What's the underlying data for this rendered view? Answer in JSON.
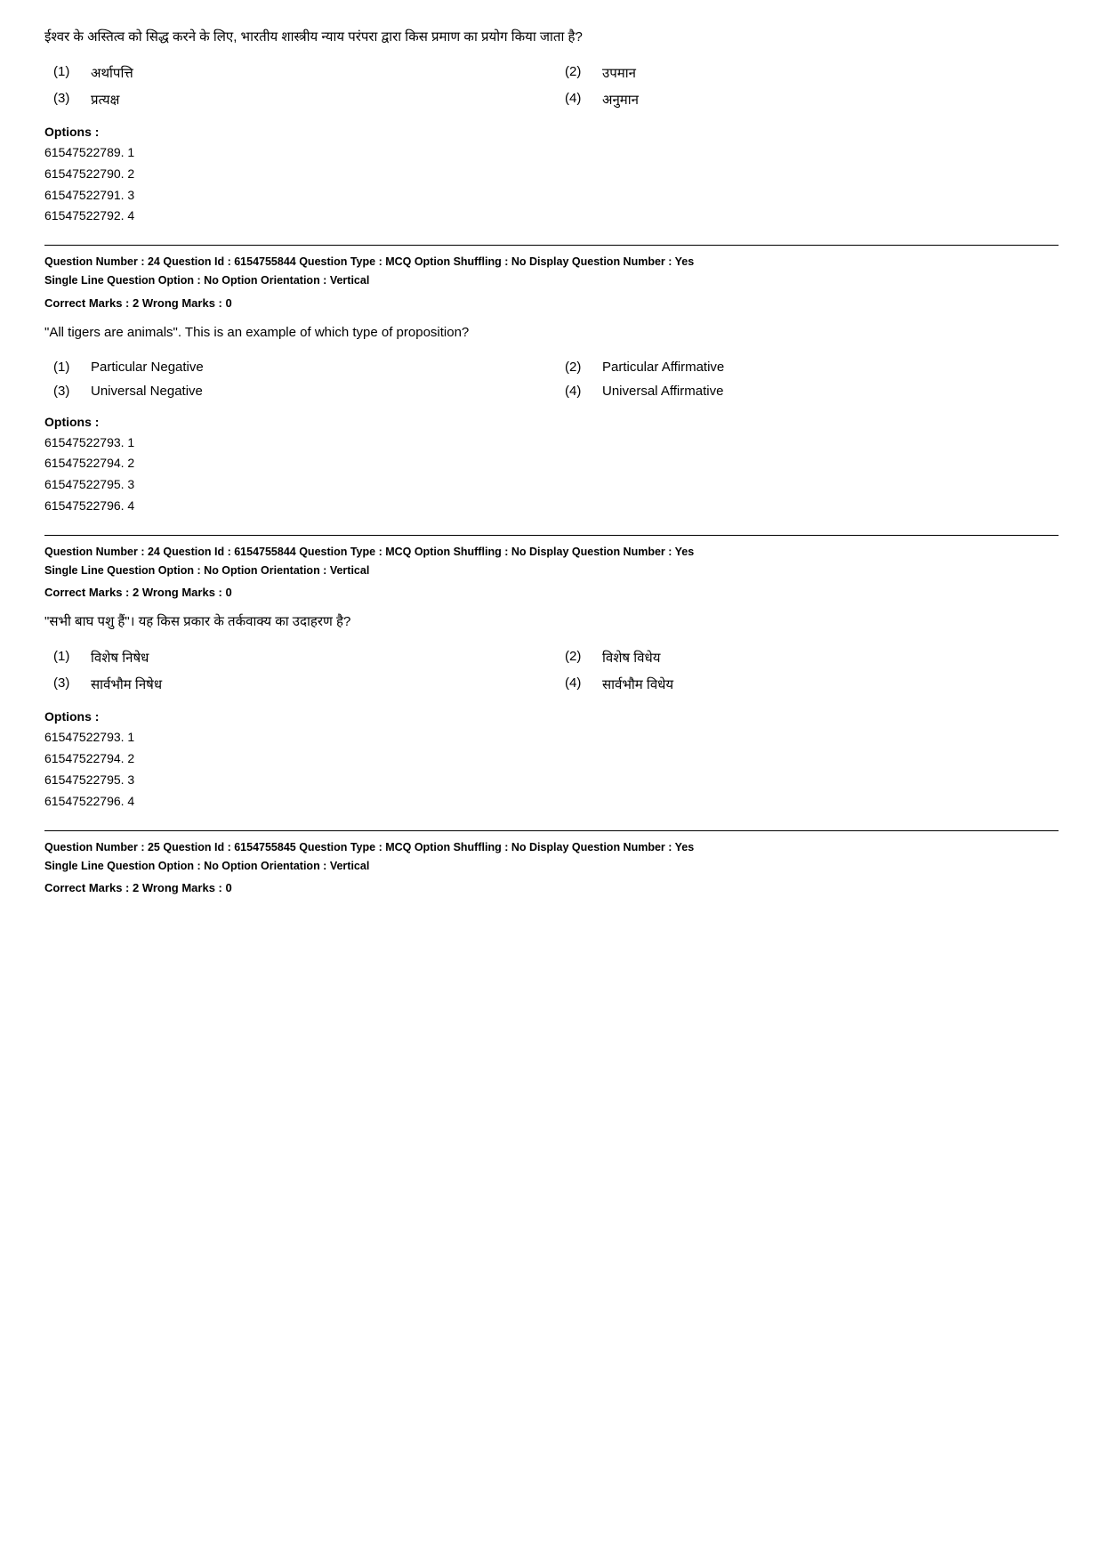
{
  "questions": [
    {
      "id": "q_top",
      "question_text": "ईश्वर के अस्तित्व को सिद्ध करने के लिए, भारतीय शास्त्रीय न्याय परंपरा द्वारा किस प्रमाण का प्रयोग किया जाता है?",
      "options": [
        {
          "number": "(1)",
          "text": "अर्थापत्ति"
        },
        {
          "number": "(2)",
          "text": "उपमान"
        },
        {
          "number": "(3)",
          "text": "प्रत्यक्ष"
        },
        {
          "number": "(4)",
          "text": "अनुमान"
        }
      ],
      "options_label": "Options :",
      "option_ids": [
        "61547522789. 1",
        "61547522790. 2",
        "61547522791. 3",
        "61547522792. 4"
      ]
    },
    {
      "id": "q24_en",
      "meta_line1": "Question Number : 24  Question Id : 6154755844  Question Type : MCQ  Option Shuffling : No  Display Question Number : Yes",
      "meta_line2": "Single Line Question Option : No  Option Orientation : Vertical",
      "correct_marks": "Correct Marks : 2  Wrong Marks : 0",
      "question_text": "\"All tigers are animals\". This is an example of which type of proposition?",
      "options": [
        {
          "number": "(1)",
          "text": "Particular Negative"
        },
        {
          "number": "(2)",
          "text": "Particular Affirmative"
        },
        {
          "number": "(3)",
          "text": "Universal Negative"
        },
        {
          "number": "(4)",
          "text": "Universal Affirmative"
        }
      ],
      "options_label": "Options :",
      "option_ids": [
        "61547522793. 1",
        "61547522794. 2",
        "61547522795. 3",
        "61547522796. 4"
      ]
    },
    {
      "id": "q24_hi",
      "meta_line1": "Question Number : 24  Question Id : 6154755844  Question Type : MCQ  Option Shuffling : No  Display Question Number : Yes",
      "meta_line2": "Single Line Question Option : No  Option Orientation : Vertical",
      "correct_marks": "Correct Marks : 2  Wrong Marks : 0",
      "question_text": "\"सभी बाघ पशु हैं\"। यह किस प्रकार के तर्कवाक्य का उदाहरण है?",
      "options": [
        {
          "number": "(1)",
          "text": "विशेष निषेध"
        },
        {
          "number": "(2)",
          "text": "विशेष विधेय"
        },
        {
          "number": "(3)",
          "text": "सार्वभौम निषेध"
        },
        {
          "number": "(4)",
          "text": "सार्वभौम विधेय"
        }
      ],
      "options_label": "Options :",
      "option_ids": [
        "61547522793. 1",
        "61547522794. 2",
        "61547522795. 3",
        "61547522796. 4"
      ]
    },
    {
      "id": "q25",
      "meta_line1": "Question Number : 25  Question Id : 6154755845  Question Type : MCQ  Option Shuffling : No  Display Question Number : Yes",
      "meta_line2": "Single Line Question Option : No  Option Orientation : Vertical",
      "correct_marks": "Correct Marks : 2  Wrong Marks : 0"
    }
  ]
}
